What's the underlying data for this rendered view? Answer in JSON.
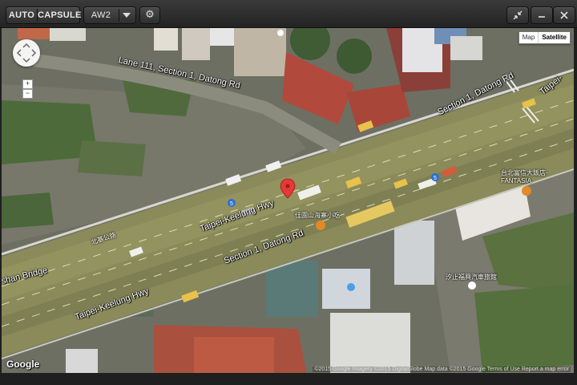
{
  "toolbar": {
    "auto_label": "AUTO",
    "capsule_label": "CAPSULE",
    "channel_value": "AW2",
    "settings_icon": "gear-icon",
    "collapse_icon": "collapse-arrows-icon",
    "minimize_icon": "minimize-icon",
    "close_icon": "close-icon"
  },
  "map": {
    "type_buttons": [
      "Map",
      "Satellite"
    ],
    "selected_type": "Satellite",
    "zoom_in": "+",
    "zoom_out": "−",
    "pan_control_icon": "pan-arrows-icon",
    "marker_icon": "red-map-marker-icon",
    "logo": "Google",
    "attribution": "©2015 Google Imagery ©2015 DigitalGlobe  Map data ©2015 Google  Terms of Use  Report a map error",
    "road_labels": [
      "Lane 111, Section 1, Datong Rd",
      "Section 1, Datong Rd",
      "Taipei-Keelung Hwy",
      "Section 1, Datong Rd",
      "Taipei-Keelung Hwy",
      "shan Bridge",
      "Taipei-"
    ],
    "poi_labels": [
      "北基公路",
      "佳園山海寨小吃",
      "台北富信大飯店-\nFANTASIA",
      "汐止福興汽車旅館"
    ],
    "road_markers": [
      "5",
      "5"
    ],
    "colors": {
      "road": "#8a8a5a",
      "roof_red": "#a94a3c",
      "vegetation": "#4d6b3a"
    }
  }
}
